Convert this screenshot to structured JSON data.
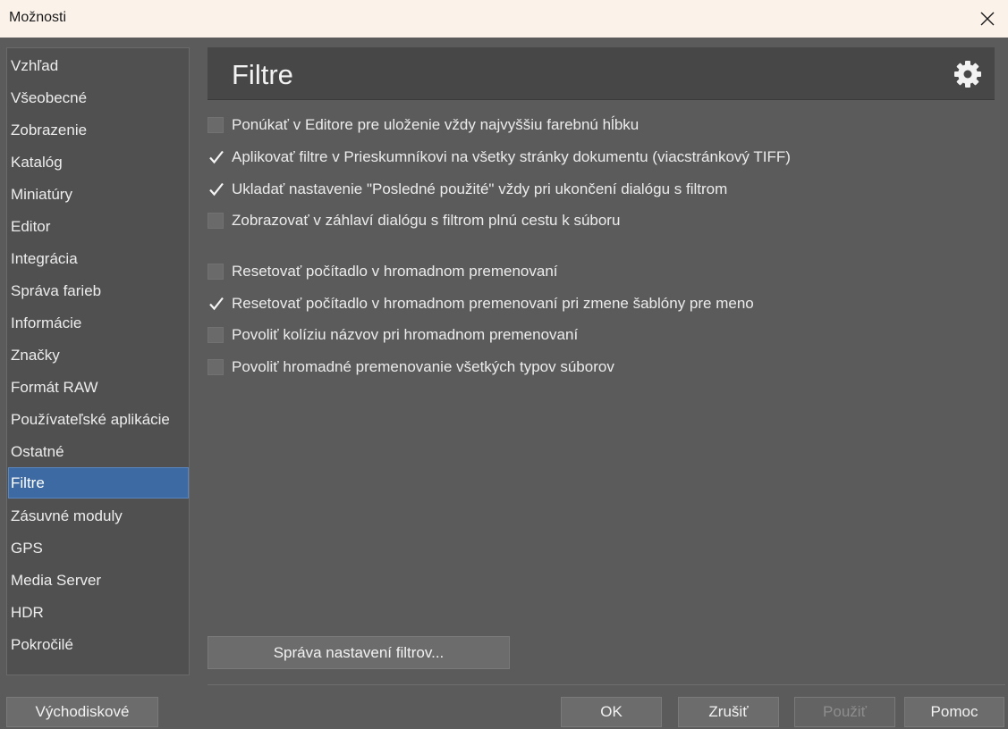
{
  "window": {
    "title": "Možnosti"
  },
  "sidebar": {
    "items": [
      {
        "label": "Vzhľad"
      },
      {
        "label": "Všeobecné"
      },
      {
        "label": "Zobrazenie"
      },
      {
        "label": "Katalóg"
      },
      {
        "label": "Miniatúry"
      },
      {
        "label": "Editor"
      },
      {
        "label": "Integrácia"
      },
      {
        "label": "Správa farieb"
      },
      {
        "label": "Informácie"
      },
      {
        "label": "Značky"
      },
      {
        "label": "Formát RAW"
      },
      {
        "label": "Používateľské aplikácie"
      },
      {
        "label": "Ostatné"
      },
      {
        "label": "Filtre",
        "selected": true
      },
      {
        "label": "Zásuvné moduly"
      },
      {
        "label": "GPS"
      },
      {
        "label": "Media Server"
      },
      {
        "label": "HDR"
      },
      {
        "label": "Pokročilé"
      }
    ]
  },
  "header": {
    "title": "Filtre",
    "icon": "gear-icon"
  },
  "options": [
    {
      "label": "Ponúkať v Editore pre uloženie vždy najvyššiu farebnú hĺbku",
      "checked": false
    },
    {
      "label": "Aplikovať filtre v Prieskumníkovi na všetky stránky dokumentu (viacstránkový TIFF)",
      "checked": true
    },
    {
      "label": "Ukladať nastavenie \"Posledné použité\" vždy pri ukončení dialógu s filtrom",
      "checked": true
    },
    {
      "label": "Zobrazovať v záhlaví dialógu s filtrom plnú cestu k súboru",
      "checked": false
    },
    {
      "label": "Resetovať počítadlo v hromadnom premenovaní",
      "checked": false
    },
    {
      "label": "Resetovať počítadlo v hromadnom premenovaní pri zmene šablóny pre meno",
      "checked": true
    },
    {
      "label": "Povoliť kolíziu názvov pri hromadnom premenovaní",
      "checked": false
    },
    {
      "label": "Povoliť hromadné premenovanie všetkých typov súborov",
      "checked": false
    }
  ],
  "manage_button": "Správa nastavení filtrov...",
  "footer": {
    "defaults": "Východiskové",
    "ok": "OK",
    "cancel": "Zrušiť",
    "apply": "Použiť",
    "help": "Pomoc"
  }
}
